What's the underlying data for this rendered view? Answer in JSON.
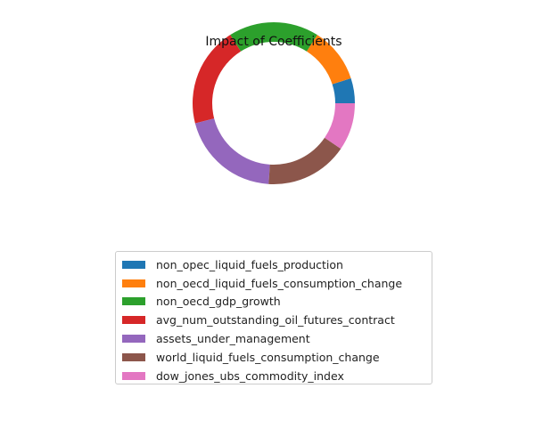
{
  "chart_data": {
    "type": "pie",
    "style": "donut",
    "title": "Impact of Coefficients",
    "legend_position": "lower-center",
    "slices": [
      {
        "label": "non_opec_liquid_fuels_production",
        "value": 5.0,
        "color": "#1f77b4"
      },
      {
        "label": "non_oecd_liquid_fuels_consumption_change",
        "value": 11.0,
        "color": "#ff7f0e"
      },
      {
        "label": "non_oecd_gdp_growth",
        "value": 18.0,
        "color": "#2ca02c"
      },
      {
        "label": "avg_num_outstanding_oil_futures_contract",
        "value": 20.0,
        "color": "#d62728"
      },
      {
        "label": "assets_under_management",
        "value": 20.0,
        "color": "#9467bd"
      },
      {
        "label": "world_liquid_fuels_consumption_change",
        "value": 16.5,
        "color": "#8c564b"
      },
      {
        "label": "dow_jones_ubs_commodity_index",
        "value": 9.5,
        "color": "#e377c2"
      }
    ]
  }
}
